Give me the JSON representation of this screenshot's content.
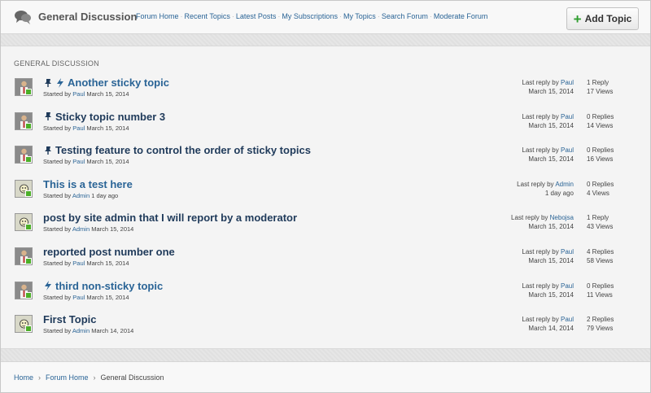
{
  "header": {
    "title": "General Discussion",
    "nav": [
      "Forum Home",
      "Recent Topics",
      "Latest Posts",
      "My Subscriptions",
      "My Topics",
      "Search Forum",
      "Moderate Forum"
    ],
    "add_button": "Add Topic"
  },
  "section_title": "GENERAL DISCUSSION",
  "labels": {
    "started_by": "Started by",
    "last_reply_by": "Last reply by"
  },
  "topics": [
    {
      "title": "Another sticky topic",
      "sticky": true,
      "flash": true,
      "author": "Paul",
      "date": "March 15, 2014",
      "last_user": "Paul",
      "last_date": "March 15, 2014",
      "replies": "1 Reply",
      "views": "17 Views",
      "avatar": "paul"
    },
    {
      "title": "Sticky topic number 3",
      "sticky": true,
      "flash": false,
      "author": "Paul",
      "date": "March 15, 2014",
      "last_user": "Paul",
      "last_date": "March 15, 2014",
      "replies": "0 Replies",
      "views": "14 Views",
      "avatar": "paul"
    },
    {
      "title": "Testing feature to control the order of sticky topics",
      "sticky": true,
      "flash": false,
      "author": "Paul",
      "date": "March 15, 2014",
      "last_user": "Paul",
      "last_date": "March 15, 2014",
      "replies": "0 Replies",
      "views": "16 Views",
      "avatar": "paul"
    },
    {
      "title": "This is a test here",
      "sticky": false,
      "flash": false,
      "author": "Admin",
      "date": "1 day ago",
      "last_user": "Admin",
      "last_date": "1 day ago",
      "replies": "0 Replies",
      "views": "4 Views",
      "avatar": "admin"
    },
    {
      "title": "post by site admin that I will report by a moderator",
      "sticky": false,
      "flash": false,
      "author": "Admin",
      "date": "March 15, 2014",
      "last_user": "Nebojsa",
      "last_date": "March 15, 2014",
      "replies": "1 Reply",
      "views": "43 Views",
      "avatar": "admin"
    },
    {
      "title": "reported post number one",
      "sticky": false,
      "flash": false,
      "author": "Paul",
      "date": "March 15, 2014",
      "last_user": "Paul",
      "last_date": "March 15, 2014",
      "replies": "4 Replies",
      "views": "58 Views",
      "avatar": "paul"
    },
    {
      "title": "third non-sticky topic",
      "sticky": false,
      "flash": true,
      "author": "Paul",
      "date": "March 15, 2014",
      "last_user": "Paul",
      "last_date": "March 15, 2014",
      "replies": "0 Replies",
      "views": "11 Views",
      "avatar": "paul"
    },
    {
      "title": "First Topic",
      "sticky": false,
      "flash": false,
      "author": "Admin",
      "date": "March 14, 2014",
      "last_user": "Paul",
      "last_date": "March 14, 2014",
      "replies": "2 Replies",
      "views": "79 Views",
      "avatar": "admin"
    }
  ],
  "breadcrumb": [
    "Home",
    "Forum Home",
    "General Discussion"
  ],
  "colors": {
    "link": "#2a6496",
    "online": "#4caf28",
    "add_plus": "#2f9e2f"
  }
}
